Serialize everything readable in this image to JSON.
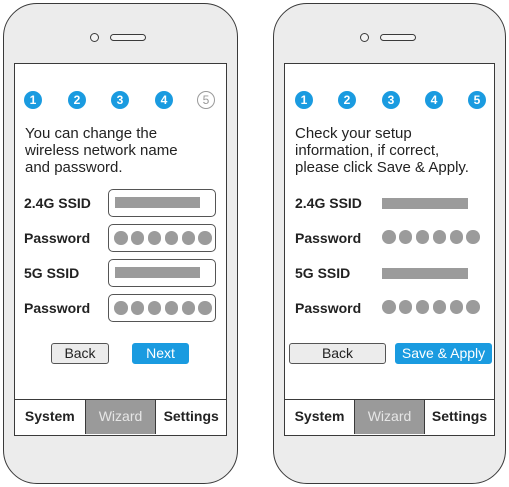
{
  "colors": {
    "accent": "#1a9be0",
    "placeholder_gray": "#9b9b9b",
    "active_tab": "#9a9a9a"
  },
  "screens": [
    {
      "name": "wizard-edit",
      "steps": [
        {
          "label": "1",
          "state": "done"
        },
        {
          "label": "2",
          "state": "done"
        },
        {
          "label": "3",
          "state": "done"
        },
        {
          "label": "4",
          "state": "current"
        },
        {
          "label": "5",
          "state": "pending"
        }
      ],
      "intro_lines": [
        "You can change the",
        "wireless network name",
        "and password."
      ],
      "fields": [
        {
          "label": "2.4G SSID",
          "kind": "ssid"
        },
        {
          "label": "Password",
          "kind": "password",
          "mask_length": 6
        },
        {
          "label": "5G SSID",
          "kind": "ssid"
        },
        {
          "label": "Password",
          "kind": "password",
          "mask_length": 6
        }
      ],
      "buttons": {
        "back": "Back",
        "primary": "Next"
      },
      "tabs": [
        {
          "label": "System",
          "active": false
        },
        {
          "label": "Wizard",
          "active": true
        },
        {
          "label": "Settings",
          "active": false
        }
      ]
    },
    {
      "name": "wizard-confirm",
      "steps": [
        {
          "label": "1",
          "state": "done"
        },
        {
          "label": "2",
          "state": "done"
        },
        {
          "label": "3",
          "state": "done"
        },
        {
          "label": "4",
          "state": "done"
        },
        {
          "label": "5",
          "state": "current"
        }
      ],
      "intro_lines": [
        "Check your setup",
        "information, if correct,",
        "please click Save & Apply."
      ],
      "fields": [
        {
          "label": "2.4G SSID",
          "kind": "ssid"
        },
        {
          "label": "Password",
          "kind": "password",
          "mask_length": 6
        },
        {
          "label": "5G SSID",
          "kind": "ssid"
        },
        {
          "label": "Password",
          "kind": "password",
          "mask_length": 6
        }
      ],
      "buttons": {
        "back": "Back",
        "primary": "Save & Apply"
      },
      "tabs": [
        {
          "label": "System",
          "active": false
        },
        {
          "label": "Wizard",
          "active": true
        },
        {
          "label": "Settings",
          "active": false
        }
      ]
    }
  ]
}
